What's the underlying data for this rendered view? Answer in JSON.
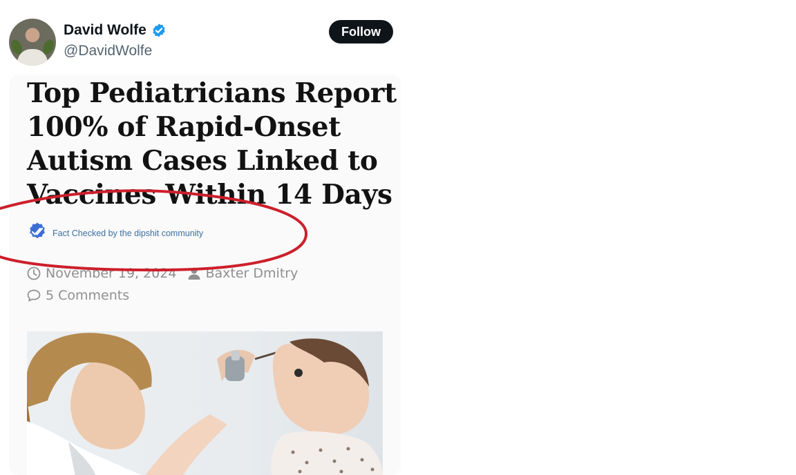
{
  "author": {
    "display_name": "David Wolfe",
    "handle": "@DavidWolfe",
    "verified": true
  },
  "actions": {
    "follow_label": "Follow"
  },
  "article": {
    "headline_lines": [
      "Top Pediatricians Report",
      "100% of Rapid-Onset",
      "Autism Cases Linked to",
      "Vaccines Within 14 Days"
    ],
    "fact_check_label": "Fact Checked by the dipshit community",
    "date": "November 19, 2024",
    "author_name": "Baxter Dmitry",
    "comments": "5 Comments"
  },
  "icons": {
    "verified": "verified-badge-icon",
    "fact_check": "double-check-icon",
    "date": "clock-icon",
    "author": "person-icon",
    "comments": "speech-bubble-icon"
  },
  "colors": {
    "verified_blue": "#1d9bf0",
    "follow_bg": "#0f1419",
    "annotation_red": "#cc1f2b",
    "fact_check_blue": "#3b6fd4"
  }
}
